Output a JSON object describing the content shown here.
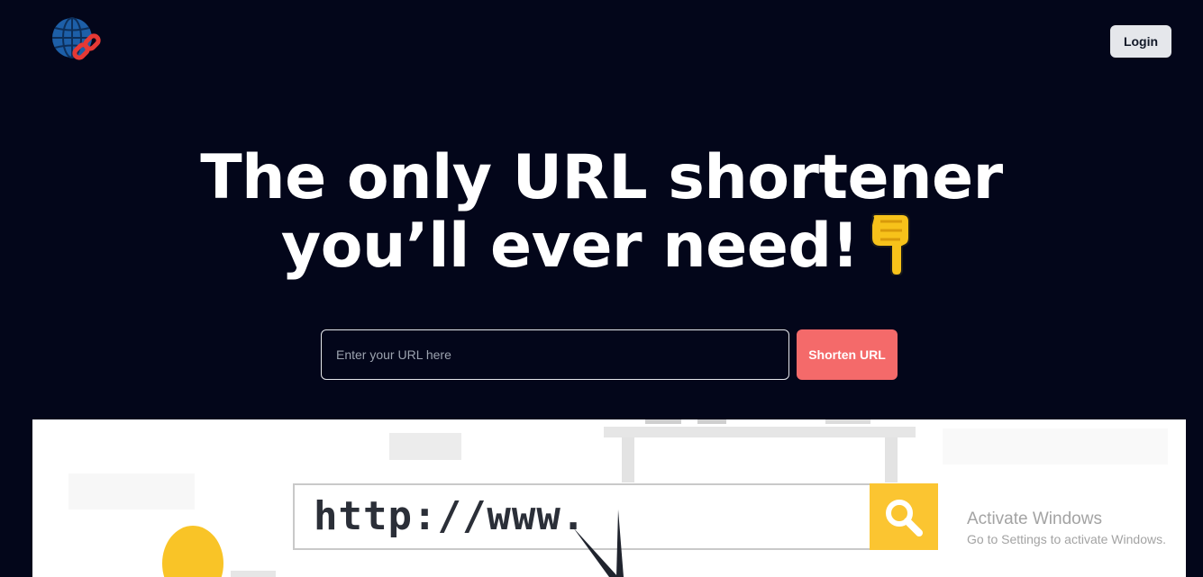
{
  "header": {
    "logo_icon": "globe-link-icon",
    "login_label": "Login"
  },
  "hero": {
    "line1": "The only URL shortener",
    "line2": "you’ll ever need!",
    "emoji_icon": "pointing-down-hand-icon"
  },
  "form": {
    "url_placeholder": "Enter your URL here",
    "url_value": "",
    "submit_label": "Shorten URL"
  },
  "illustration": {
    "browser_text": "http://www.",
    "search_icon": "search-icon"
  },
  "watermark": {
    "title": "Activate Windows",
    "subtitle": "Go to Settings to activate Windows."
  },
  "colors": {
    "background": "#03061a",
    "accent": "#f46a6a",
    "button_light": "#e5e7eb",
    "search_yellow": "#fbc531"
  }
}
